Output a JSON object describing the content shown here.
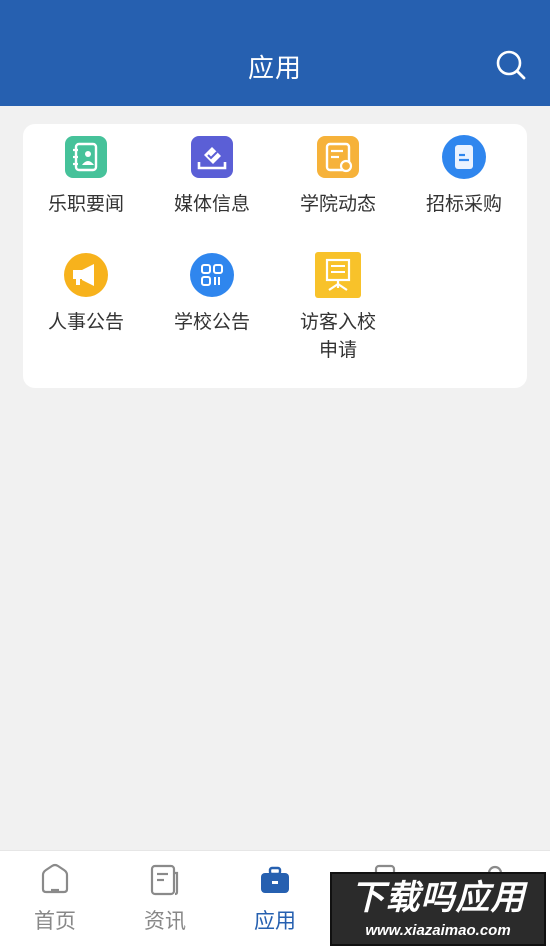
{
  "header": {
    "title": "应用",
    "search_icon": "search-icon"
  },
  "apps": [
    {
      "label": "乐职要闻",
      "icon": "contact-book-icon",
      "color": "#46c29a"
    },
    {
      "label": "媒体信息",
      "icon": "inbox-check-icon",
      "color": "#5b5fd6"
    },
    {
      "label": "学院动态",
      "icon": "notice-bell-icon",
      "color": "#f6b23a"
    },
    {
      "label": "招标采购",
      "icon": "document-icon",
      "color": "#2f86ee"
    },
    {
      "label": "人事公告",
      "icon": "megaphone-icon",
      "color": "#f7b21c"
    },
    {
      "label": "学校公告",
      "icon": "grid-qr-icon",
      "color": "#2f86ee"
    },
    {
      "label": "访客入校申请",
      "label_line1": "访客入校",
      "label_line2": "申请",
      "icon": "presentation-board-icon",
      "color": "#f8c22a"
    }
  ],
  "tabbar": {
    "items": [
      {
        "label": "首页",
        "icon": "home-icon",
        "active": false
      },
      {
        "label": "资讯",
        "icon": "news-icon",
        "active": false
      },
      {
        "label": "应用",
        "icon": "briefcase-icon",
        "active": true
      },
      {
        "label": "",
        "icon": "phone-icon",
        "active": false
      },
      {
        "label": "",
        "icon": "user-icon",
        "active": false
      }
    ],
    "active_color": "#2660b0",
    "inactive_color": "#888888"
  },
  "watermark": {
    "main": "下载吗应用",
    "sub": "www.xiazaimao.com"
  }
}
